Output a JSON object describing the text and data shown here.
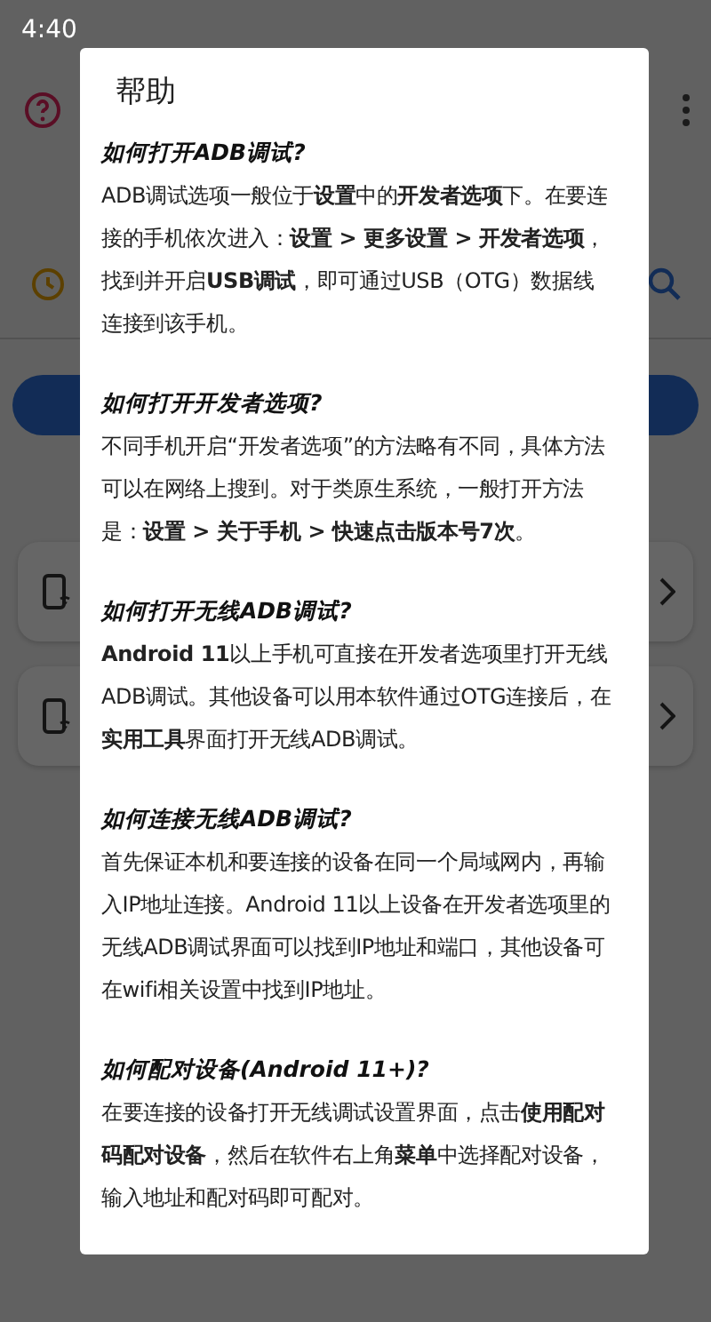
{
  "status_bar": {
    "time": "4:40"
  },
  "dialog": {
    "title": "帮助",
    "sections": [
      {
        "heading": "如何打开ADB调试?",
        "body": "ADB调试选项一般位于**设置**中的**开发者选项**下。在要连接的手机依次进入：**设置 > 更多设置 > 开发者选项**，找到并开启**USB调试**，即可通过USB（OTG）数据线连接到该手机。"
      },
      {
        "heading": "如何打开开发者选项?",
        "body": "不同手机开启“开发者选项”的方法略有不同，具体方法可以在网络上搜到。对于类原生系统，一般打开方法是：**设置 > 关于手机 > 快速点击版本号7次**。"
      },
      {
        "heading": "如何打开无线ADB调试?",
        "body": "**Android 11**以上手机可直接在开发者选项里打开无线ADB调试。其他设备可以用本软件通过OTG连接后，在**实用工具**界面打开无线ADB调试。"
      },
      {
        "heading": "如何连接无线ADB调试?",
        "body": "首先保证本机和要连接的设备在同一个局域网内，再输入IP地址连接。Android 11以上设备在开发者选项里的无线ADB调试界面可以找到IP地址和端口，其他设备可在wifi相关设置中找到IP地址。"
      },
      {
        "heading": "如何配对设备(Android 11+)?",
        "body": "在要连接的设备打开无线调试设置界面，点击**使用配对码配对设备**，然后在软件右上角**菜单**中选择配对设备，输入地址和配对码即可配对。"
      }
    ]
  }
}
